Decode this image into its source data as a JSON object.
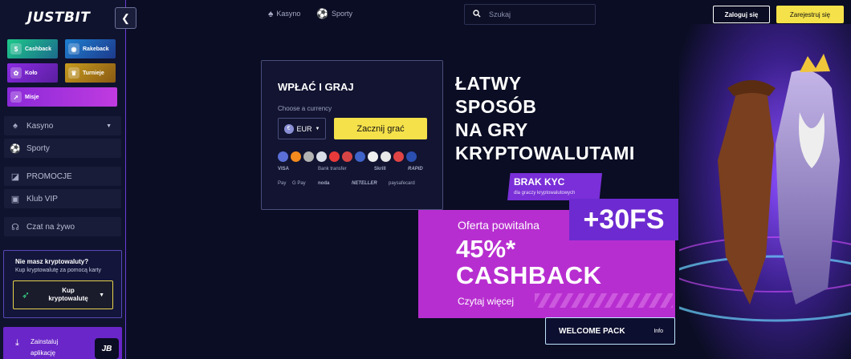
{
  "brand": {
    "logo": "JUSTBIT"
  },
  "sidebar": {
    "tiles": {
      "cashback": "Cashback",
      "rakeback": "Rakeback",
      "kolo": "Koło",
      "turnieje": "Turnieje",
      "misje": "Misje"
    },
    "nav": {
      "kasyno": "Kasyno",
      "sporty": "Sporty",
      "promocje": "PROMOCJE",
      "klub_vip": "Klub VIP",
      "czat": "Czat na żywo"
    },
    "crypto": {
      "title": "Nie masz kryptowaluty?",
      "subtitle": "Kup kryptowalutę za pomocą karty",
      "button_line1": "Kup",
      "button_line2": "kryptowalutę"
    },
    "install": {
      "line1": "Zainstaluj",
      "line2": "aplikację",
      "badge": "JB"
    }
  },
  "header": {
    "tabs": {
      "casino": "Kasyno",
      "sports": "Sporty"
    },
    "search": {
      "placeholder": "Szukaj"
    },
    "login": "Zaloguj się",
    "register": "Zarejestruj się"
  },
  "deposit": {
    "title": "WPŁAĆ I GRAJ",
    "choose_label": "Choose a currency",
    "currency": "EUR",
    "start_button": "Zacznij grać",
    "payments_row1": [
      "VISA",
      "Bank transfer",
      "Skrill",
      "RAPID"
    ],
    "payments_row2": [
      "Pay",
      "G Pay",
      "noda",
      "NETELLER",
      "paysafecard"
    ]
  },
  "hero": {
    "headline": [
      "ŁATWY",
      "SPOSÓB",
      "NA GRY",
      "KRYPTOWALUTAMI"
    ],
    "kyc_title": "BRAK KYC",
    "kyc_sub": "dla graczy kryptowalutowych",
    "free_spins": "+30FS",
    "offer": "Oferta powitalna",
    "percent": "45%*",
    "cashback": "CASHBACK",
    "read_more": "Czytaj więcej",
    "welcome_pack": "WELCOME PACK",
    "info": "Info"
  },
  "colors": {
    "accent_yellow": "#f5e14a",
    "accent_purple": "#7a2fd8",
    "promo_magenta": "#b72ed0",
    "background": "#0b0d24"
  },
  "coins": [
    "#5b6fd6",
    "#f28a1e",
    "#b3b3b3",
    "#d8dde8",
    "#e83a3a",
    "#d64545",
    "#3f63c8",
    "#f0f0f0",
    "#e8e8e8",
    "#e04444",
    "#2a4fb0"
  ]
}
